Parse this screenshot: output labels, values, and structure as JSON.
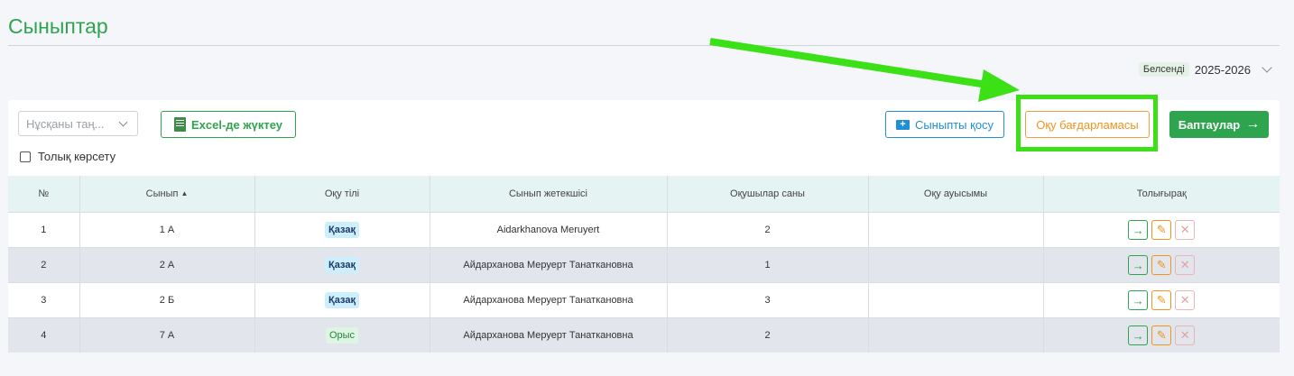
{
  "page": {
    "title": "Сыныптар"
  },
  "year": {
    "badge": "Белсенді",
    "value": "2025-2026"
  },
  "toolbar": {
    "select_placeholder": "Нұсқаны таң...",
    "excel_label": "Excel-де жүктеу",
    "excel_icon": "xls-file-icon",
    "add_class_label": "Сыныпты қосу",
    "add_class_icon": "folder-plus-icon",
    "program_label": "Оқу бағдарламасы",
    "settings_label": "Баптаулар",
    "full_view_label": "Толық көрсету"
  },
  "table": {
    "columns": [
      "№",
      "Сынып",
      "Оқу тілі",
      "Сынып жетекшісі",
      "Оқушылар саны",
      "Оқу ауысымы",
      "Толығырақ"
    ],
    "rows": [
      {
        "num": "1",
        "class": "1 А",
        "lang": "Қазақ",
        "teacher": "Aidarkhanova Meruyert",
        "count": "2",
        "shift": ""
      },
      {
        "num": "2",
        "class": "2 А",
        "lang": "Қазақ",
        "teacher": "Айдарханова Меруерт Танаткановна",
        "count": "1",
        "shift": ""
      },
      {
        "num": "3",
        "class": "2 Б",
        "lang": "Қазақ",
        "teacher": "Айдарханова Меруерт Танаткановна",
        "count": "3",
        "shift": ""
      },
      {
        "num": "4",
        "class": "7 А",
        "lang": "Орыс",
        "teacher": "Айдарханова Меруерт Танаткановна",
        "count": "2",
        "shift": ""
      }
    ]
  },
  "colors": {
    "accent_green": "#2fa44f",
    "highlight": "#3ce016",
    "blue": "#1f8fd8",
    "orange": "#f0941e"
  }
}
